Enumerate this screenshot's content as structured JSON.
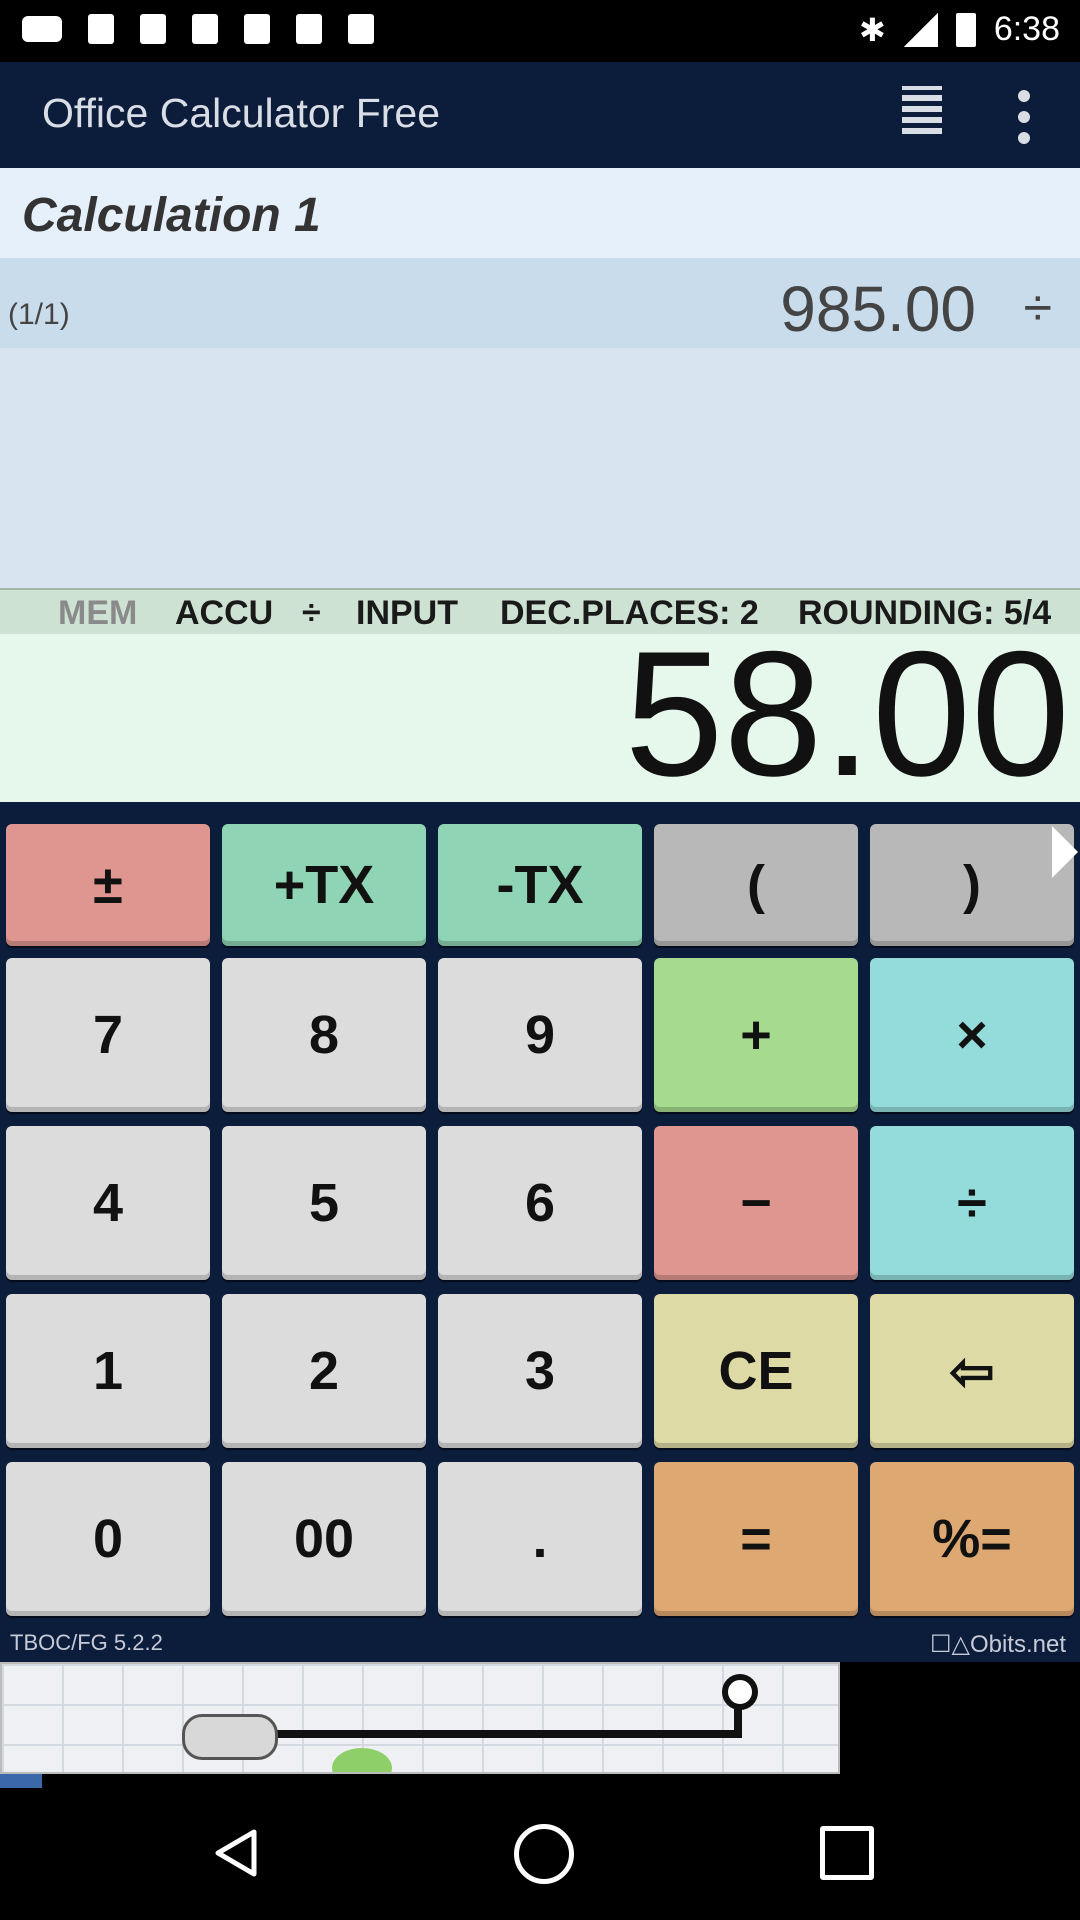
{
  "status_bar": {
    "time": "6:38",
    "icons": [
      "message-icon",
      "image-icon",
      "image-icon",
      "image-icon",
      "image-icon",
      "image-icon",
      "image-icon",
      "bluetooth-icon",
      "signal-icon",
      "battery-icon"
    ],
    "bluetooth_glyph": "✱"
  },
  "app_bar": {
    "title": "Office Calculator Free",
    "icons": [
      "tape-list-icon",
      "more-vert-icon"
    ]
  },
  "calculation": {
    "title": "Calculation 1",
    "tape": [
      {
        "index": "(1/1)",
        "value": "985.00",
        "operator": "÷"
      }
    ]
  },
  "status_line": {
    "mem": "MEM",
    "accu": "ACCU",
    "pending_op": "÷",
    "mode": "INPUT",
    "dec_places": "DEC.PLACES: 2",
    "rounding": "ROUNDING: 5/4"
  },
  "display": {
    "value": "58.00"
  },
  "keypad": {
    "row0": [
      "±",
      "+TX",
      "-TX",
      "(",
      ")"
    ],
    "row1": [
      "7",
      "8",
      "9",
      "+",
      "×"
    ],
    "row2": [
      "4",
      "5",
      "6",
      "−",
      "÷"
    ],
    "row3": [
      "1",
      "2",
      "3",
      "CE",
      "⇦"
    ],
    "row4": [
      "0",
      "00",
      ".",
      "=",
      "%="
    ]
  },
  "footer": {
    "version": "TBOC/FG 5.2.2",
    "site": "☐△Obits.net"
  },
  "colors": {
    "app_bar": "#0c1c3b",
    "key_gray": "#dcdcdc",
    "key_pink": "#e09690",
    "key_teal": "#8fd4b4",
    "key_green": "#a6da8e",
    "key_cyan": "#94dbdb",
    "key_sand": "#dedaa6",
    "key_orange": "#dea872"
  }
}
